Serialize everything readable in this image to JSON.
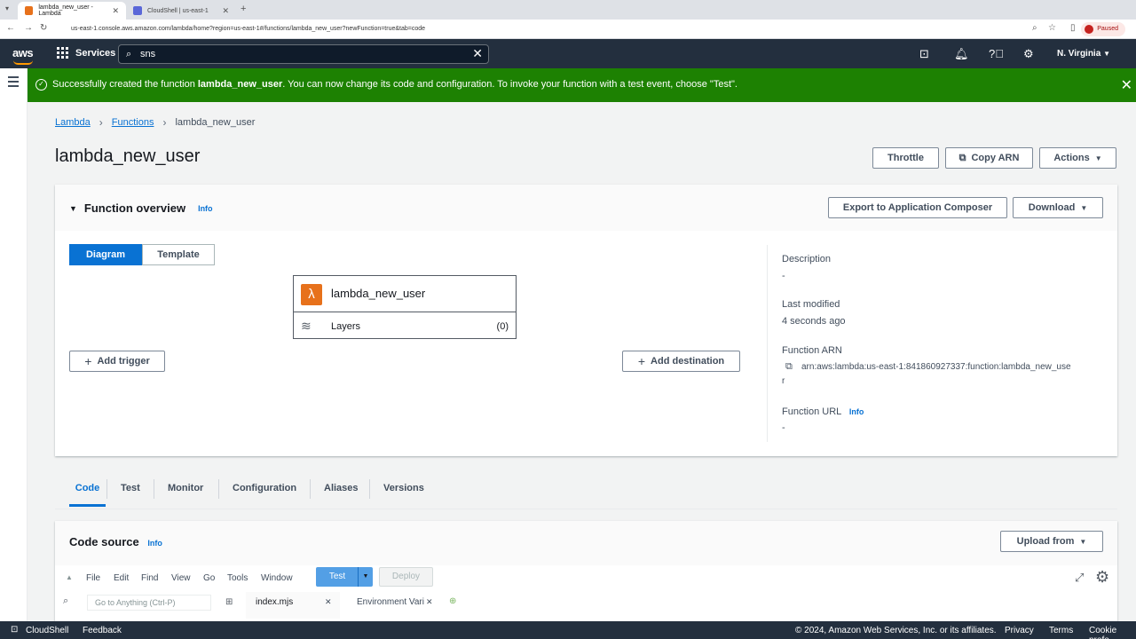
{
  "browser": {
    "tabs": [
      {
        "label": "lambda_new_user - Lambda",
        "active": true
      },
      {
        "label": "CloudShell | us-east-1",
        "active": false
      }
    ],
    "url": "us-east-1.console.aws.amazon.com/lambda/home?region=us-east-1#/functions/lambda_new_user?newFunction=true&tab=code",
    "profile_status": "Paused"
  },
  "aws_nav": {
    "logo": "aws",
    "services_label": "Services",
    "search_value": "sns",
    "region": "N. Virginia"
  },
  "flash": {
    "prefix": "Successfully created the function ",
    "function_name": "lambda_new_user",
    "suffix": ". You can now change its code and configuration. To invoke your function with a test event, choose \"Test\".",
    "color": "#1d8102"
  },
  "breadcrumb": {
    "items": [
      "Lambda",
      "Functions"
    ],
    "current": "lambda_new_user"
  },
  "page": {
    "title": "lambda_new_user",
    "throttle_label": "Throttle",
    "copy_arn_label": "Copy ARN",
    "actions_label": "Actions"
  },
  "overview": {
    "title": "Function overview",
    "info": "Info",
    "export_label": "Export to Application Composer",
    "download_label": "Download",
    "diagram_tab": "Diagram",
    "template_tab": "Template",
    "function_name": "lambda_new_user",
    "layers_label": "Layers",
    "layers_count": "(0)",
    "add_trigger_label": "Add trigger",
    "add_destination_label": "Add destination",
    "description_label": "Description",
    "description_value": "-",
    "last_modified_label": "Last modified",
    "last_modified_value": "4 seconds ago",
    "arn_label": "Function ARN",
    "arn_line1": "arn:aws:lambda:us-east-1:841860927337:function:lambda_new_use",
    "arn_line2": "r",
    "url_label": "Function URL",
    "url_info": "Info",
    "url_value": "-"
  },
  "tabs": [
    "Code",
    "Test",
    "Monitor",
    "Configuration",
    "Aliases",
    "Versions"
  ],
  "code_source": {
    "title": "Code source",
    "info": "Info",
    "upload_label": "Upload from",
    "menus": [
      "File",
      "Edit",
      "Find",
      "View",
      "Go",
      "Tools",
      "Window"
    ],
    "test_label": "Test",
    "deploy_label": "Deploy",
    "goto_placeholder": "Go to Anything (Ctrl-P)",
    "file_tabs": [
      "index.mjs",
      "Environment Vari"
    ]
  },
  "footer": {
    "cloudshell": "CloudShell",
    "feedback": "Feedback",
    "copyright": "© 2024, Amazon Web Services, Inc. or its affiliates.",
    "privacy": "Privacy",
    "terms": "Terms",
    "cookie": "Cookie prefe"
  }
}
